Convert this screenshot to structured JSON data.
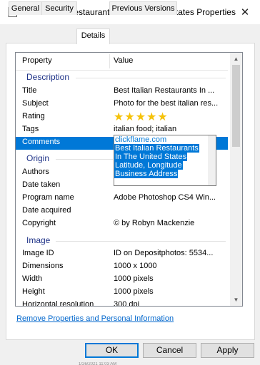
{
  "window": {
    "title": "Best Italian Restaurants In The United States Properties",
    "close_glyph": "✕"
  },
  "tabs": [
    {
      "label": "General"
    },
    {
      "label": "Security"
    },
    {
      "label": "Details"
    },
    {
      "label": "Previous Versions"
    }
  ],
  "columns": {
    "property": "Property",
    "value": "Value"
  },
  "groups": {
    "description": "Description",
    "origin": "Origin",
    "image": "Image"
  },
  "description_rows": {
    "title": {
      "name": "Title",
      "value": "Best Italian Restaurants In ..."
    },
    "subject": {
      "name": "Subject",
      "value": "Photo for the best italian res..."
    },
    "rating": {
      "name": "Rating",
      "stars": "★★★★★",
      "value": 5
    },
    "tags": {
      "name": "Tags",
      "value": "italian food; italian"
    },
    "comments": {
      "name": "Comments",
      "lines": [
        "clickflame.com",
        "Best Italian Restaurants",
        "In The United States",
        "Latitude, Longitude",
        "Business Address"
      ]
    }
  },
  "origin_rows": {
    "authors": {
      "name": "Authors",
      "value": ""
    },
    "date_taken": {
      "name": "Date taken",
      "value": ""
    },
    "program": {
      "name": "Program name",
      "value": "Adobe Photoshop CS4 Win..."
    },
    "date_acquired": {
      "name": "Date acquired",
      "value": ""
    },
    "copyright": {
      "name": "Copyright",
      "value": "© by Robyn Mackenzie"
    }
  },
  "image_rows": {
    "image_id": {
      "name": "Image ID",
      "value": "ID on Depositphotos: 5534..."
    },
    "dimensions": {
      "name": "Dimensions",
      "value": "1000 x 1000"
    },
    "width": {
      "name": "Width",
      "value": "1000 pixels"
    },
    "height": {
      "name": "Height",
      "value": "1000 pixels"
    },
    "hres": {
      "name": "Horizontal resolution",
      "value": "300 dpi"
    }
  },
  "remove_link": "Remove Properties and Personal Information",
  "buttons": {
    "ok": "OK",
    "cancel": "Cancel",
    "apply": "Apply"
  },
  "background_text": "1/26/2021 11:03 AM"
}
